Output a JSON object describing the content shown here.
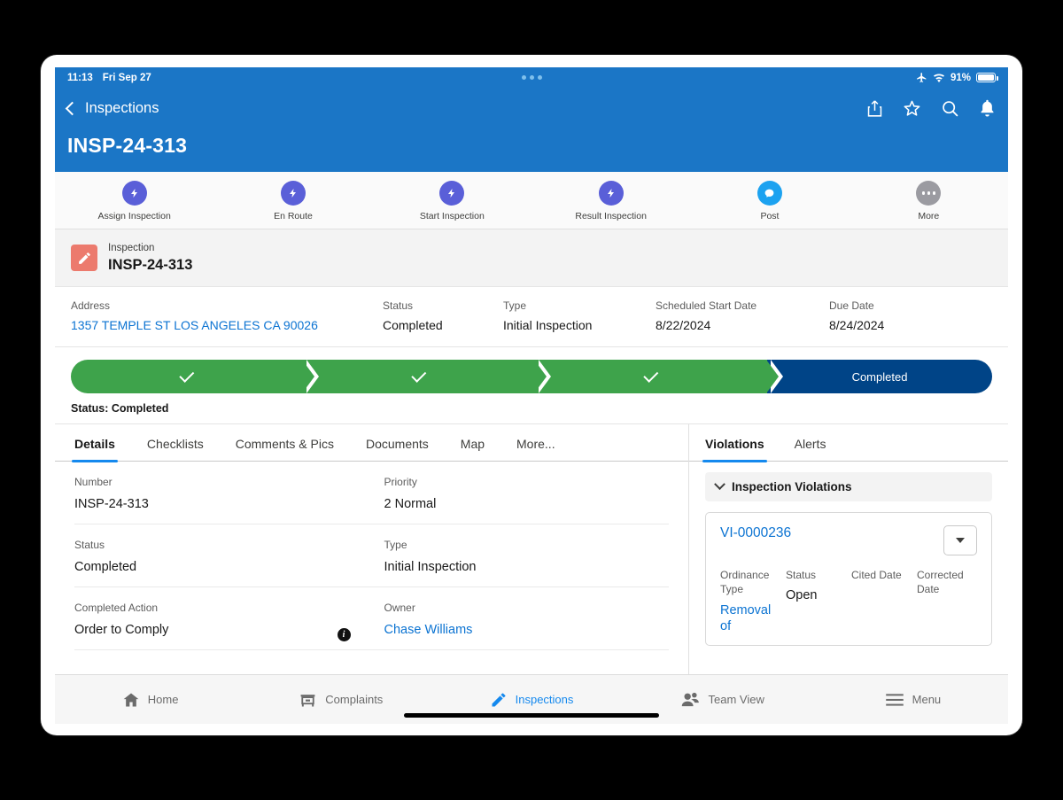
{
  "status_bar": {
    "time": "11:13",
    "date": "Fri Sep 27",
    "battery_percent": "91%",
    "airplane_icon": "airplane-icon",
    "wifi_icon": "wifi-icon",
    "battery_icon": "battery-icon",
    "dynamic_island": "dynamic-island-dots"
  },
  "header": {
    "back_label": "Inspections",
    "title": "INSP-24-313",
    "actions": [
      {
        "name": "share-icon",
        "label": "Share"
      },
      {
        "name": "favorite-star-icon",
        "label": "Favorite"
      },
      {
        "name": "search-icon",
        "label": "Search"
      },
      {
        "name": "notifications-bell-icon",
        "label": "Notifications"
      }
    ]
  },
  "action_bar": [
    {
      "label": "Assign Inspection",
      "icon": "lightning-bolt-icon",
      "style": "bolt"
    },
    {
      "label": "En Route",
      "icon": "lightning-bolt-icon",
      "style": "bolt"
    },
    {
      "label": "Start Inspection",
      "icon": "lightning-bolt-icon",
      "style": "bolt"
    },
    {
      "label": "Result Inspection",
      "icon": "lightning-bolt-icon",
      "style": "bolt"
    },
    {
      "label": "Post",
      "icon": "chatter-post-icon",
      "style": "post"
    },
    {
      "label": "More",
      "icon": "more-ellipsis-icon",
      "style": "more"
    }
  ],
  "record_header": {
    "object_label": "Inspection",
    "record_name": "INSP-24-313",
    "icon": "pencil-record-icon",
    "icon_color": "#ec7a6d",
    "fields": [
      {
        "label": "Address",
        "value": "1357 TEMPLE ST LOS ANGELES CA 90026",
        "link": true
      },
      {
        "label": "Status",
        "value": "Completed",
        "link": false
      },
      {
        "label": "Type",
        "value": "Initial Inspection",
        "link": false
      },
      {
        "label": "Scheduled Start Date",
        "value": "8/22/2024",
        "link": false
      },
      {
        "label": "Due Date",
        "value": "8/24/2024",
        "link": false
      }
    ]
  },
  "path": {
    "steps": [
      {
        "label": "",
        "state": "done"
      },
      {
        "label": "",
        "state": "done"
      },
      {
        "label": "",
        "state": "done"
      },
      {
        "label": "Completed",
        "state": "current"
      }
    ],
    "status_text": "Status: Completed",
    "done_color": "#3ea34b",
    "current_color": "#004487"
  },
  "left_pane": {
    "tabs": [
      {
        "label": "Details",
        "active": true
      },
      {
        "label": "Checklists",
        "active": false
      },
      {
        "label": "Comments & Pics",
        "active": false
      },
      {
        "label": "Documents",
        "active": false
      },
      {
        "label": "Map",
        "active": false
      },
      {
        "label": "More...",
        "active": false
      }
    ],
    "fields": [
      {
        "label": "Number",
        "value": "INSP-24-313",
        "link": false,
        "info": false
      },
      {
        "label": "Priority",
        "value": "2 Normal",
        "link": false,
        "info": false
      },
      {
        "label": "Status",
        "value": "Completed",
        "link": false,
        "info": false
      },
      {
        "label": "Type",
        "value": "Initial Inspection",
        "link": false,
        "info": false
      },
      {
        "label": "Completed Action",
        "value": "Order to Comply",
        "link": false,
        "info": true
      },
      {
        "label": "Owner",
        "value": "Chase Williams",
        "link": true,
        "info": false
      }
    ]
  },
  "right_pane": {
    "tabs": [
      {
        "label": "Violations",
        "active": true
      },
      {
        "label": "Alerts",
        "active": false
      }
    ],
    "section_title": "Inspection Violations",
    "section_chevron": "chevron-down-icon",
    "violation": {
      "id": "VI-0000236",
      "menu_icon": "dropdown-caret-icon",
      "columns": [
        {
          "label": "Ordinance Type",
          "value": "Removal of",
          "link": true
        },
        {
          "label": "Status",
          "value": "Open",
          "link": false
        },
        {
          "label": "Cited Date",
          "value": "",
          "link": false
        },
        {
          "label": "Corrected Date",
          "value": "",
          "link": false
        }
      ]
    }
  },
  "bottom_nav": [
    {
      "label": "Home",
      "icon": "home-icon",
      "active": false
    },
    {
      "label": "Complaints",
      "icon": "complaints-icon",
      "active": false
    },
    {
      "label": "Inspections",
      "icon": "pencil-icon",
      "active": true
    },
    {
      "label": "Team View",
      "icon": "team-people-icon",
      "active": false
    },
    {
      "label": "Menu",
      "icon": "hamburger-menu-icon",
      "active": false
    }
  ],
  "colors": {
    "brand_blue": "#1b76c6",
    "link_blue": "#0b73d2",
    "accent_blue": "#1589ee",
    "path_done_green": "#3ea34b",
    "path_current_navy": "#004487"
  }
}
